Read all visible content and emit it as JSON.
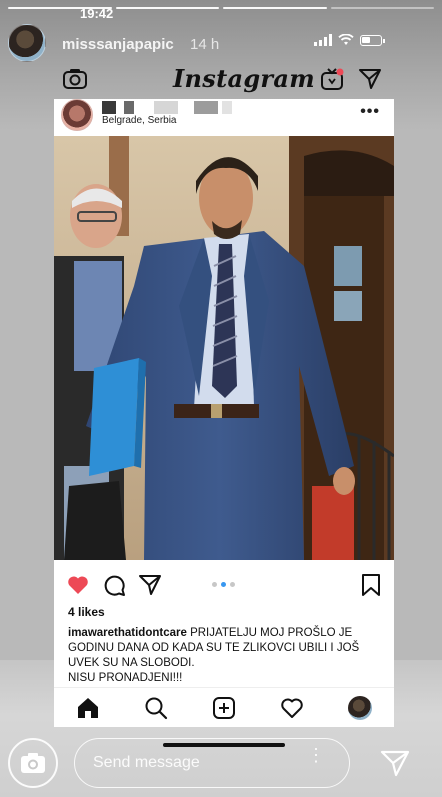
{
  "status_bar": {
    "time": "19:42"
  },
  "story": {
    "username": "misssanjapapic",
    "time_ago": "14 h",
    "progress_segments": 4,
    "progress_done": 3
  },
  "instagram": {
    "logo_text": "Instagram"
  },
  "post": {
    "location": "Belgrade, Serbia",
    "more_label": "•••",
    "carousel": {
      "count": 3,
      "active": 2
    },
    "likes_text": "4 likes",
    "caption_user": "imawarethatidontcare",
    "caption_text": "PRIJATELJU MOJ PROŠLO JE GODINU DANA OD KADA SU TE ZLIKOVCI UBILI I JOŠ UVEK SU NA SLOBODI.",
    "caption_text2": "NISU PRONADJENI!!!"
  },
  "reply": {
    "placeholder": "Send message",
    "more_label": "⋮"
  },
  "colors": {
    "like_red": "#ed4956",
    "carousel_blue": "#3897f0",
    "text_dark": "#111111"
  },
  "icons": {
    "camera": "camera-icon",
    "igtv": "igtv-icon",
    "direct": "direct-message-icon",
    "like": "heart-filled-icon",
    "comment": "comment-icon",
    "share": "share-icon",
    "save": "bookmark-icon",
    "home": "home-icon",
    "search": "search-icon",
    "new_post": "plus-square-icon",
    "activity": "heart-outline-icon",
    "profile": "profile-avatar",
    "send": "send-icon"
  }
}
